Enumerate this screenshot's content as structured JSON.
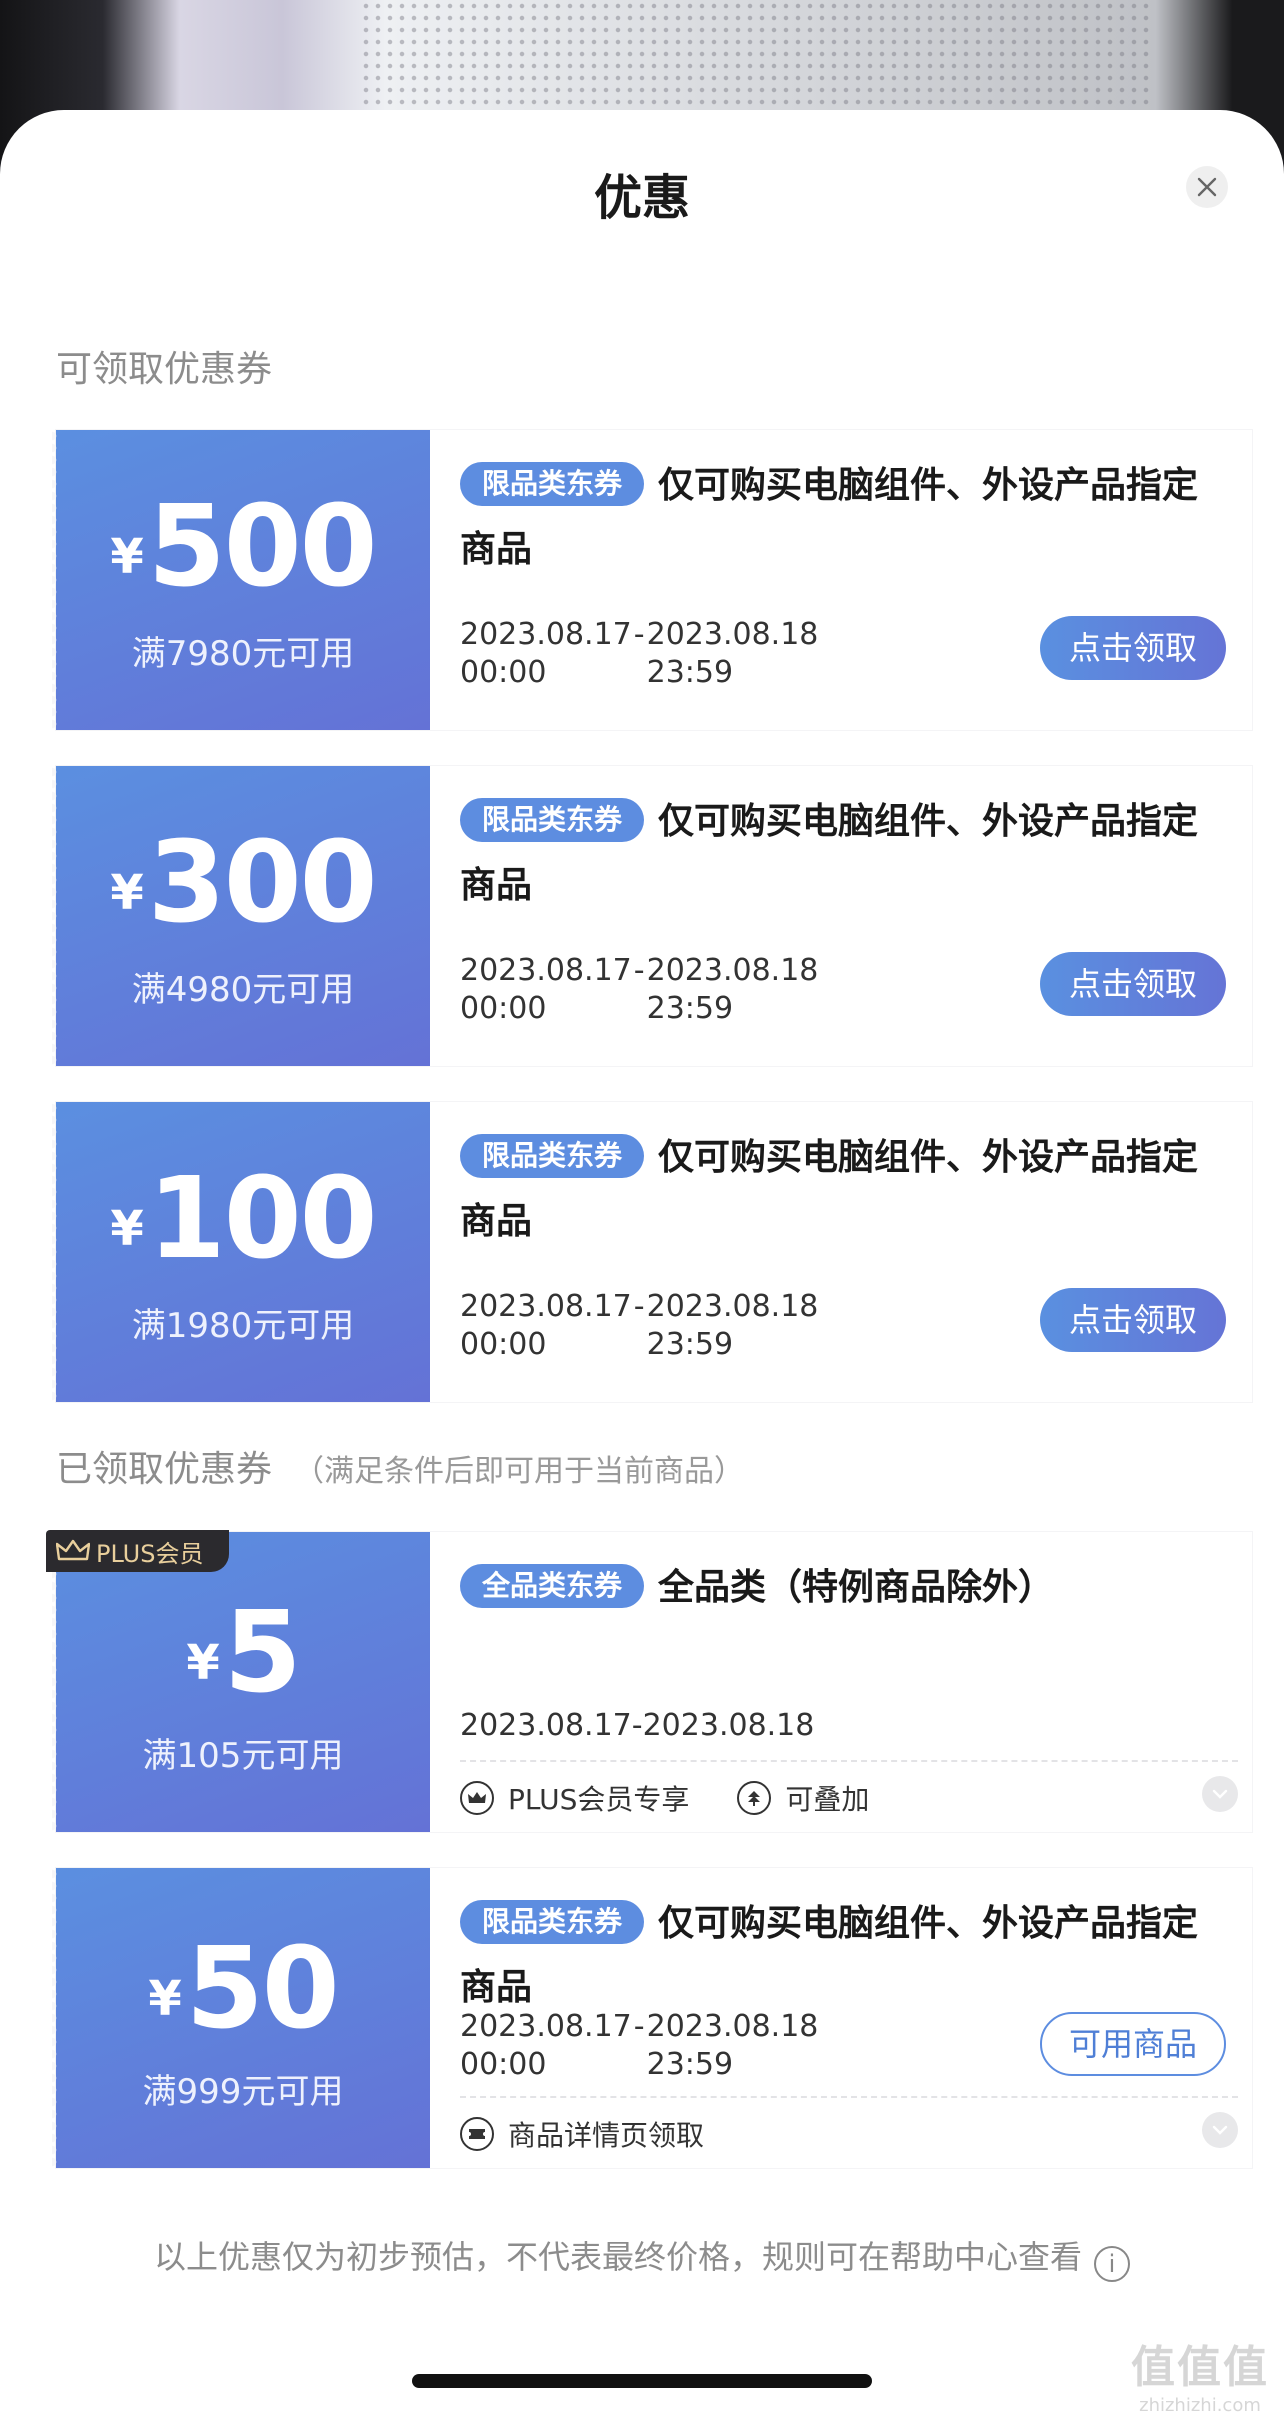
{
  "sheet": {
    "title": "优惠"
  },
  "sections": {
    "available_title": "可领取优惠券",
    "claimed_title": "已领取优惠券",
    "claimed_subtitle": "（满足条件后即可用于当前商品）"
  },
  "available_coupons": [
    {
      "yen": "¥",
      "amount": "500",
      "threshold": "满7980元可用",
      "tag": "限品类东券",
      "desc": "仅可购买电脑组件、外设产品指定商品",
      "start_date": "2023.08.17",
      "start_time": "00:00",
      "sep": "-",
      "end_date": "2023.08.18",
      "end_time": "23:59",
      "button": "点击领取"
    },
    {
      "yen": "¥",
      "amount": "300",
      "threshold": "满4980元可用",
      "tag": "限品类东券",
      "desc": "仅可购买电脑组件、外设产品指定商品",
      "start_date": "2023.08.17",
      "start_time": "00:00",
      "sep": "-",
      "end_date": "2023.08.18",
      "end_time": "23:59",
      "button": "点击领取"
    },
    {
      "yen": "¥",
      "amount": "100",
      "threshold": "满1980元可用",
      "tag": "限品类东券",
      "desc": "仅可购买电脑组件、外设产品指定商品",
      "start_date": "2023.08.17",
      "start_time": "00:00",
      "sep": "-",
      "end_date": "2023.08.18",
      "end_time": "23:59",
      "button": "点击领取"
    }
  ],
  "claimed_coupons": [
    {
      "badge": "PLUS会员",
      "yen": "¥",
      "amount": "5",
      "threshold": "满105元可用",
      "tag": "全品类东券",
      "desc": "全品类（特例商品除外）",
      "date_range": "2023.08.17-2023.08.18",
      "features": [
        "PLUS会员专享",
        "可叠加"
      ]
    },
    {
      "yen": "¥",
      "amount": "50",
      "threshold": "满999元可用",
      "tag": "限品类东券",
      "desc": "仅可购买电脑组件、外设产品指定商品",
      "start_date": "2023.08.17",
      "start_time": "00:00",
      "sep": "-",
      "end_date": "2023.08.18",
      "end_time": "23:59",
      "button": "可用商品",
      "features": [
        "商品详情页领取"
      ]
    }
  ],
  "footer": {
    "note": "以上优惠仅为初步预估，不代表最终价格，规则可在帮助中心查看",
    "info_glyph": "i"
  },
  "watermark": {
    "big": "值值值",
    "small": "zhizhizhi.com"
  },
  "colors": {
    "coupon_gradient_start": "#5b8fe0",
    "coupon_gradient_end": "#6472d6",
    "tag_bg": "#5d8de0",
    "plus_badge_bg": "#2b2a2e",
    "plus_badge_text": "#e9cf9c"
  }
}
